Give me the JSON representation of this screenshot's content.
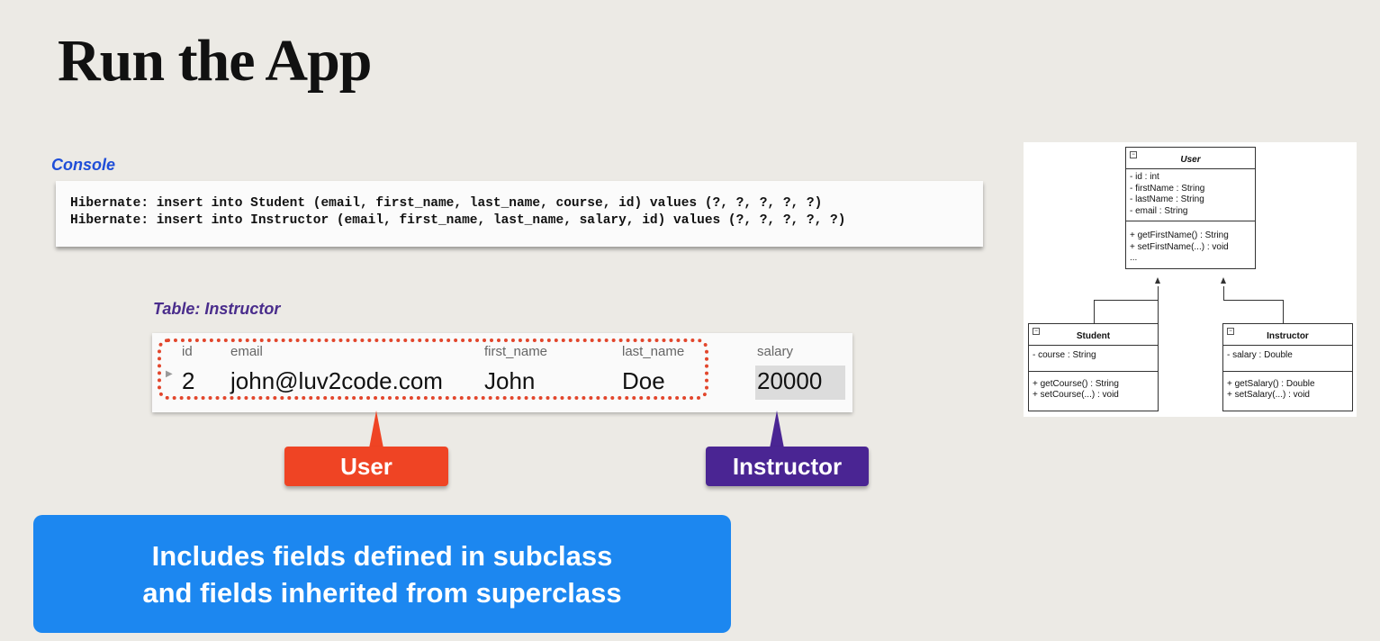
{
  "slide": {
    "title": "Run the App"
  },
  "console": {
    "label": "Console",
    "lines": [
      "Hibernate: insert into Student (email, first_name, last_name, course, id) values (?, ?, ?, ?, ?)",
      "Hibernate: insert into Instructor (email, first_name, last_name, salary, id) values (?, ?, ?, ?, ?)"
    ]
  },
  "table": {
    "label": "Table: Instructor",
    "columns": [
      "id",
      "email",
      "first_name",
      "last_name",
      "salary"
    ],
    "row": [
      "2",
      "john@luv2code.com",
      "John",
      "Doe",
      "20000"
    ]
  },
  "callouts": {
    "user": "User",
    "instructor": "Instructor"
  },
  "note": {
    "line1": "Includes fields defined in subclass",
    "line2": "and fields inherited from superclass"
  },
  "uml": {
    "user": {
      "name": "User",
      "fields": [
        "- id : int",
        "- firstName : String",
        "- lastName : String",
        "- email : String"
      ],
      "methods": [
        "+ getFirstName() : String",
        "+ setFirstName(...) : void",
        "..."
      ]
    },
    "student": {
      "name": "Student",
      "fields": [
        "- course : String"
      ],
      "methods": [
        "+ getCourse() : String",
        "+ setCourse(...) : void"
      ]
    },
    "instructor": {
      "name": "Instructor",
      "fields": [
        "- salary : Double"
      ],
      "methods": [
        "+ getSalary() : Double",
        "+ setSalary(...) : void"
      ]
    }
  },
  "colors": {
    "user_callout": "#ef4424",
    "instructor_callout": "#4a2593",
    "note_bg": "#1c87f0",
    "console_label": "#1f4ed8",
    "table_label": "#4a2d8c"
  }
}
